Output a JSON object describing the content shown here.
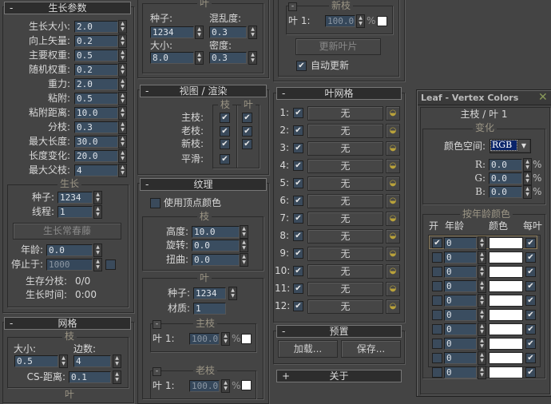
{
  "growth": {
    "title": "生长参数",
    "collapse": "-",
    "params": [
      {
        "label": "生长大小:",
        "value": "2.0"
      },
      {
        "label": "向上矢量:",
        "value": "0.2"
      },
      {
        "label": "主要权重:",
        "value": "0.5"
      },
      {
        "label": "随机权重:",
        "value": "0.2"
      },
      {
        "label": "重力:",
        "value": "2.0"
      },
      {
        "label": "粘附:",
        "value": "0.5"
      },
      {
        "label": "粘附距离:",
        "value": "10.0"
      },
      {
        "label": "分枝:",
        "value": "0.3"
      },
      {
        "label": "最大长度:",
        "value": "30.0"
      },
      {
        "label": "长度变化:",
        "value": "20.0"
      },
      {
        "label": "最大父枝:",
        "value": "4"
      }
    ],
    "group": "生长",
    "seed_label": "种子:",
    "seed": "1234",
    "threads_label": "线程:",
    "threads": "1",
    "grow_button": "生长常春藤",
    "age_label": "年龄:",
    "age": "0.0",
    "stop_label": "停止于:",
    "stop": "1000",
    "branches_label": "生存分枝:",
    "branches": "0/0",
    "time_label": "生长时间:",
    "time": "0:00"
  },
  "mesh": {
    "title": "网格",
    "collapse": "-",
    "group": "枝",
    "size_label": "大小:",
    "size": "0.5",
    "sides_label": "边数:",
    "sides": "4",
    "cs_label": "CS-距离:",
    "cs": "0.1",
    "leaf_group": "叶"
  },
  "leaf": {
    "group": "叶",
    "seed_label": "种子:",
    "seed": "1234",
    "chaos_label": "混乱度:",
    "chaos": "0.3",
    "size_label": "大小:",
    "size": "8.0",
    "density_label": "密度:",
    "density": "0.3"
  },
  "view": {
    "title": "视图 / 渲染",
    "collapse": "-",
    "col_branch": "枝",
    "col_leaf": "叶",
    "rows": [
      {
        "label": "主枝:",
        "branch": true,
        "leaf": true
      },
      {
        "label": "老枝:",
        "branch": true,
        "leaf": true
      },
      {
        "label": "新枝:",
        "branch": true,
        "leaf": true
      },
      {
        "label": "平滑:",
        "branch": true
      }
    ]
  },
  "texture": {
    "title": "纹理",
    "collapse": "-",
    "use_vc": "使用顶点颜色",
    "branch_group": "枝",
    "height_label": "高度:",
    "height": "10.0",
    "rot_label": "旋转:",
    "rot": "0.0",
    "twist_label": "扭曲:",
    "twist": "0.0",
    "leaf_group": "叶",
    "seed_label": "种子:",
    "seed": "1234",
    "mat_label": "材质:",
    "mat": "1",
    "main": {
      "title": "主枝",
      "leaf_label": "叶 1:",
      "value": "100.0",
      "pct": "%"
    },
    "old": {
      "title": "老枝",
      "leaf_label": "叶 1:",
      "value": "100.0",
      "pct": "%"
    },
    "new": {
      "title": "新枝",
      "leaf_label": "叶 1:",
      "value": "100.0",
      "pct": "%"
    },
    "update_button": "更新叶片",
    "auto_update": "自动更新"
  },
  "leafmesh": {
    "title": "叶网格",
    "collapse": "-",
    "none": "无",
    "rows": [
      "1:",
      "2:",
      "3:",
      "4:",
      "5:",
      "6:",
      "7:",
      "8:",
      "9:",
      "10:",
      "11:",
      "12:"
    ]
  },
  "presets": {
    "title": "预置",
    "collapse": "-",
    "load": "加载...",
    "save": "保存..."
  },
  "about": {
    "title": "关于",
    "expand": "+"
  },
  "dialog": {
    "title": "Leaf - Vertex Colors",
    "subtitle": "主枝 / 叶 1",
    "var_group": "变化",
    "colorspace_label": "颜色空间:",
    "colorspace": "RGB",
    "r_label": "R:",
    "r": "0.0",
    "g_label": "G:",
    "g": "0.0",
    "b_label": "B:",
    "b": "0.0",
    "pct": "%",
    "age_group": "按年龄颜色",
    "col_on": "开",
    "col_age": "年龄",
    "col_color": "颜色",
    "col_per": "每叶",
    "rows": [
      {
        "on": true,
        "age": "0"
      },
      {
        "on": false,
        "age": "0"
      },
      {
        "on": false,
        "age": "0"
      },
      {
        "on": false,
        "age": "0"
      },
      {
        "on": false,
        "age": "0"
      },
      {
        "on": false,
        "age": "0"
      },
      {
        "on": false,
        "age": "0"
      },
      {
        "on": false,
        "age": "0"
      },
      {
        "on": false,
        "age": "0"
      },
      {
        "on": false,
        "age": "0"
      }
    ]
  },
  "colors": {
    "bg": "#444444",
    "field": "#3a4d60",
    "accent_select": "#0a246a"
  }
}
